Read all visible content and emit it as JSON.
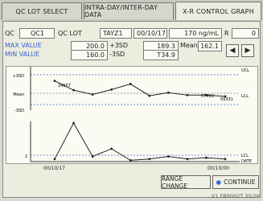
{
  "tabs": [
    {
      "label": "QC LOT SELECT"
    },
    {
      "label": "INTRA-DAY/INTER-DAY DATA"
    },
    {
      "label": "X-R CONTROL GRAPH"
    }
  ],
  "info": {
    "qc_label": "QC",
    "qc_code": "QC1",
    "lot_label": "QC LOT",
    "analyte": "TAYZ1",
    "date": "00/10/17",
    "value_display": "170 ng/mL",
    "r_label": "R",
    "r_value": "0"
  },
  "stats": {
    "max_label": "MAX VALUE",
    "max_value": "200.0",
    "plus3sd": "+3SD",
    "min_label": "MIN VALUE",
    "min_value": "160.0",
    "minus3sd": "-3SD",
    "mean_field": "189.3",
    "mean_label": "Mean",
    "mean_value": "162.1",
    "sd_field": "T34.9"
  },
  "chart": {
    "upper_labels": [
      "+3SD",
      "Mean",
      "-3SD"
    ],
    "ucl": "UCL",
    "lcl": "LCL",
    "lcl_lower": "LCL",
    "date_label": "DATE",
    "annotations": [
      "24557",
      "07493",
      "09331"
    ],
    "x_start": "00/10/17",
    "x_end": "00/10/00",
    "lower_y_labels": [
      "2",
      "0"
    ]
  },
  "chart_data": {
    "type": "line",
    "series": [
      {
        "values": [
          2,
          0.5,
          -0.2,
          0.6,
          1.5,
          -0.4,
          0.1,
          -0.3,
          -0.3,
          -0.5
        ]
      },
      {
        "values": [
          0.2,
          3.0,
          0.4,
          1.0,
          0.1,
          0.2,
          0.4,
          0.2,
          0.3,
          0.2
        ]
      }
    ]
  },
  "buttons": {
    "range_change": "RANGE CHANGE",
    "continue": "CONTINUE"
  },
  "footer": "V1 FB0002T 35/26"
}
